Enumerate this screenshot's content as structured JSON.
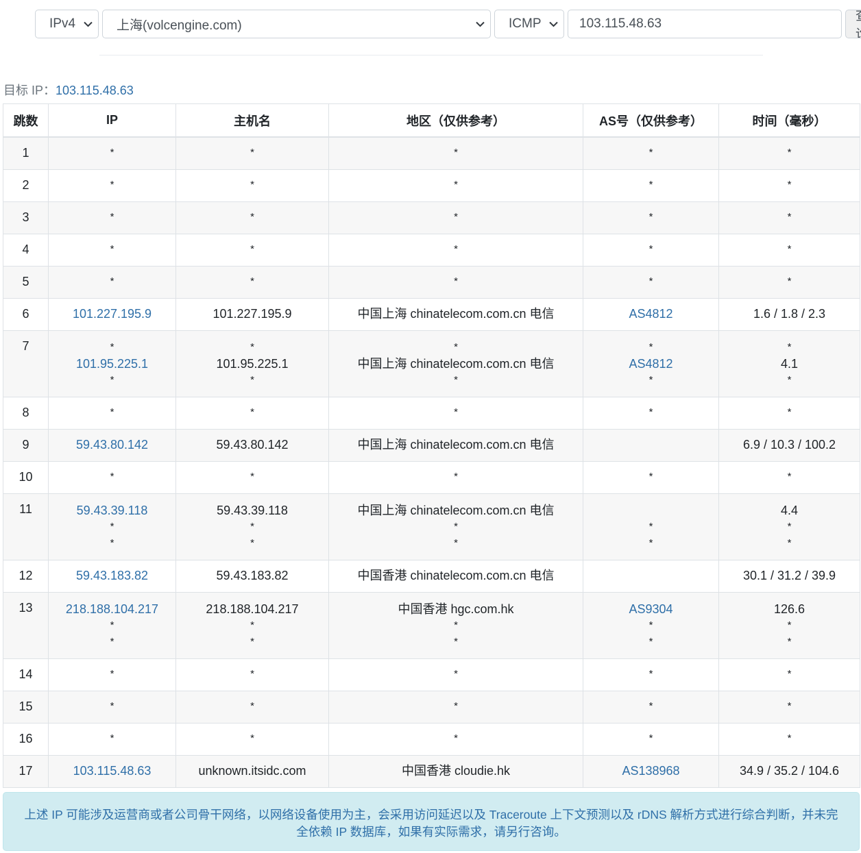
{
  "controls": {
    "ip_version": "IPv4",
    "node": "上海(volcengine.com)",
    "protocol": "ICMP",
    "target": "103.115.48.63",
    "query_label": "查询"
  },
  "target_line": {
    "label": "目标 IP：",
    "value": "103.115.48.63"
  },
  "table": {
    "headers": [
      "跳数",
      "IP",
      "主机名",
      "地区（仅供参考）",
      "AS号（仅供参考）",
      "时间（毫秒）"
    ],
    "rows": [
      {
        "hop": "1",
        "ip": [
          "*"
        ],
        "host": [
          "*"
        ],
        "region": [
          "*"
        ],
        "as": [
          "*"
        ],
        "time": [
          "*"
        ]
      },
      {
        "hop": "2",
        "ip": [
          "*"
        ],
        "host": [
          "*"
        ],
        "region": [
          "*"
        ],
        "as": [
          "*"
        ],
        "time": [
          "*"
        ]
      },
      {
        "hop": "3",
        "ip": [
          "*"
        ],
        "host": [
          "*"
        ],
        "region": [
          "*"
        ],
        "as": [
          "*"
        ],
        "time": [
          "*"
        ]
      },
      {
        "hop": "4",
        "ip": [
          "*"
        ],
        "host": [
          "*"
        ],
        "region": [
          "*"
        ],
        "as": [
          "*"
        ],
        "time": [
          "*"
        ]
      },
      {
        "hop": "5",
        "ip": [
          "*"
        ],
        "host": [
          "*"
        ],
        "region": [
          "*"
        ],
        "as": [
          "*"
        ],
        "time": [
          "*"
        ]
      },
      {
        "hop": "6",
        "ip": [
          "101.227.195.9"
        ],
        "host": [
          "101.227.195.9"
        ],
        "region": [
          "中国上海 chinatelecom.com.cn 电信"
        ],
        "as": [
          "AS4812"
        ],
        "time": [
          "1.6 / 1.8 / 2.3"
        ]
      },
      {
        "hop": "7",
        "ip": [
          "*",
          "101.95.225.1",
          "*"
        ],
        "host": [
          "*",
          "101.95.225.1",
          "*"
        ],
        "region": [
          "*",
          "中国上海 chinatelecom.com.cn 电信",
          "*"
        ],
        "as": [
          "*",
          "AS4812",
          "*"
        ],
        "time": [
          "*",
          "4.1",
          "*"
        ]
      },
      {
        "hop": "8",
        "ip": [
          "*"
        ],
        "host": [
          "*"
        ],
        "region": [
          "*"
        ],
        "as": [
          "*"
        ],
        "time": [
          "*"
        ]
      },
      {
        "hop": "9",
        "ip": [
          "59.43.80.142"
        ],
        "host": [
          "59.43.80.142"
        ],
        "region": [
          "中国上海 chinatelecom.com.cn 电信"
        ],
        "as": [
          ""
        ],
        "time": [
          "6.9 / 10.3 / 100.2"
        ]
      },
      {
        "hop": "10",
        "ip": [
          "*"
        ],
        "host": [
          "*"
        ],
        "region": [
          "*"
        ],
        "as": [
          "*"
        ],
        "time": [
          "*"
        ]
      },
      {
        "hop": "11",
        "ip": [
          "59.43.39.118",
          "*",
          "*"
        ],
        "host": [
          "59.43.39.118",
          "*",
          "*"
        ],
        "region": [
          "中国上海 chinatelecom.com.cn 电信",
          "*",
          "*"
        ],
        "as": [
          "",
          "*",
          "*"
        ],
        "time": [
          "4.4",
          "*",
          "*"
        ]
      },
      {
        "hop": "12",
        "ip": [
          "59.43.183.82"
        ],
        "host": [
          "59.43.183.82"
        ],
        "region": [
          "中国香港 chinatelecom.com.cn 电信"
        ],
        "as": [
          ""
        ],
        "time": [
          "30.1 / 31.2 / 39.9"
        ]
      },
      {
        "hop": "13",
        "ip": [
          "218.188.104.217",
          "*",
          "*"
        ],
        "host": [
          "218.188.104.217",
          "*",
          "*"
        ],
        "region": [
          "中国香港 hgc.com.hk",
          "*",
          "*"
        ],
        "as": [
          "AS9304",
          "*",
          "*"
        ],
        "time": [
          "126.6",
          "*",
          "*"
        ]
      },
      {
        "hop": "14",
        "ip": [
          "*"
        ],
        "host": [
          "*"
        ],
        "region": [
          "*"
        ],
        "as": [
          "*"
        ],
        "time": [
          "*"
        ]
      },
      {
        "hop": "15",
        "ip": [
          "*"
        ],
        "host": [
          "*"
        ],
        "region": [
          "*"
        ],
        "as": [
          "*"
        ],
        "time": [
          "*"
        ]
      },
      {
        "hop": "16",
        "ip": [
          "*"
        ],
        "host": [
          "*"
        ],
        "region": [
          "*"
        ],
        "as": [
          "*"
        ],
        "time": [
          "*"
        ]
      },
      {
        "hop": "17",
        "ip": [
          "103.115.48.63"
        ],
        "host": [
          "unknown.itsidc.com"
        ],
        "region": [
          "中国香港 cloudie.hk"
        ],
        "as": [
          "AS138968"
        ],
        "time": [
          "34.9 / 35.2 / 104.6"
        ]
      }
    ]
  },
  "notice": "上述 IP 可能涉及运营商或者公司骨干网络，以网络设备使用为主，会采用访问延迟以及 Traceroute 上下文预测以及 rDNS 解析方式进行综合判断，并未完全依赖 IP 数据库，如果有实际需求，请另行咨询。",
  "colors": {
    "link": "#2f6fa8",
    "notice_bg": "#d1ecf1",
    "stripe": "#f7f7f7"
  }
}
